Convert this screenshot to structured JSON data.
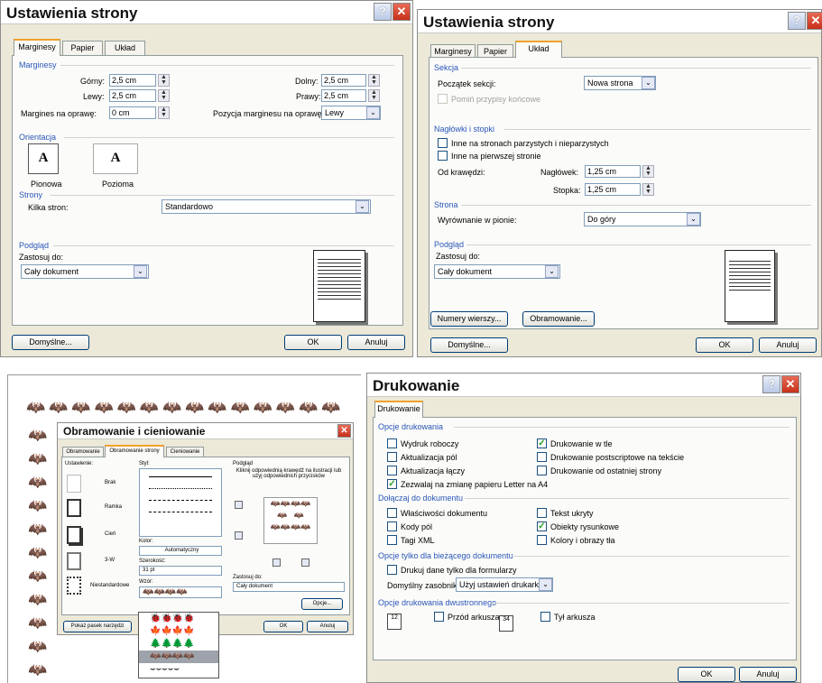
{
  "pageSetupA": {
    "title": "Ustawienia strony",
    "tabs": [
      "Marginesy",
      "Papier",
      "Układ"
    ],
    "margins": {
      "section": "Marginesy",
      "top_label": "Górny:",
      "top": "2,5 cm",
      "left_label": "Lewy:",
      "left": "2,5 cm",
      "gutter_label": "Margines na oprawę:",
      "gutter": "0 cm",
      "bottom_label": "Dolny:",
      "bottom": "2,5 cm",
      "right_label": "Prawy:",
      "right": "2,5 cm",
      "gutterpos_label": "Pozycja marginesu na oprawę:",
      "gutterpos": "Lewy"
    },
    "orientation": {
      "section": "Orientacja",
      "portrait": "Pionowa",
      "landscape": "Pozioma"
    },
    "pages": {
      "section": "Strony",
      "multiple_label": "Kilka stron:",
      "multiple": "Standardowo"
    },
    "preview": {
      "section": "Podgląd",
      "apply_label": "Zastosuj do:",
      "apply": "Cały dokument"
    },
    "default_btn": "Domyślne...",
    "ok": "OK",
    "cancel": "Anuluj"
  },
  "pageSetupB": {
    "title": "Ustawienia strony",
    "tabs": [
      "Marginesy",
      "Papier",
      "Układ"
    ],
    "section": {
      "title": "Sekcja",
      "start_label": "Początek sekcji:",
      "start": "Nowa strona",
      "suppress": "Pomiń przypisy końcowe"
    },
    "headers": {
      "title": "Nagłówki i stopki",
      "odd_even": "Inne na stronach parzystych i nieparzystych",
      "first": "Inne na pierwszej stronie",
      "from_edge": "Od krawędzi:",
      "header_label": "Nagłówek:",
      "header": "1,25 cm",
      "footer_label": "Stopka:",
      "footer": "1,25 cm"
    },
    "page": {
      "title": "Strona",
      "valign_label": "Wyrównanie w pionie:",
      "valign": "Do góry"
    },
    "preview": {
      "title": "Podgląd",
      "apply_label": "Zastosuj do:",
      "apply": "Cały dokument"
    },
    "line_numbers": "Numery wierszy...",
    "borders": "Obramowanie...",
    "default_btn": "Domyślne...",
    "ok": "OK",
    "cancel": "Anuluj"
  },
  "borders": {
    "title": "Obramowanie i cieniowanie",
    "tabs": [
      "Obramowanie",
      "Obramowanie strony",
      "Cieniowanie"
    ],
    "settings_label": "Ustawienie:",
    "settings": [
      "Brak",
      "Ramka",
      "Cień",
      "3-W",
      "Niestandardowe"
    ],
    "style_label": "Styl:",
    "color_label": "Kolor:",
    "color": "Automatyczny",
    "width_label": "Szerokość:",
    "width": "31 pt",
    "art_label": "Wzór:",
    "preview_label": "Podgląd",
    "preview_hint": "Kliknij odpowiednią krawędź na ilustracji lub użyj odpowiednich przycisków",
    "apply_label": "Zastosuj do:",
    "apply": "Cały dokument",
    "options": "Opcje...",
    "toolbar_btn": "Pokaż pasek narzędzi",
    "ok": "OK",
    "cancel": "Anuluj"
  },
  "print": {
    "title": "Drukowanie",
    "tab": "Drukowanie",
    "opts_title": "Opcje drukowania",
    "opts": [
      {
        "label": "Wydruk roboczy",
        "checked": false
      },
      {
        "label": "Drukowanie w tle",
        "checked": true
      },
      {
        "label": "Aktualizacja pól",
        "checked": false
      },
      {
        "label": "Drukowanie postscriptowe na tekście",
        "checked": false
      },
      {
        "label": "Aktualizacja łączy",
        "checked": false
      },
      {
        "label": "Drukowanie od ostatniej strony",
        "checked": false
      },
      {
        "label": "Zezwalaj na zmianę papieru Letter na A4",
        "checked": true
      }
    ],
    "include_title": "Dołączaj do dokumentu",
    "include": [
      {
        "label": "Właściwości dokumentu",
        "checked": false
      },
      {
        "label": "Tekst ukryty",
        "checked": false
      },
      {
        "label": "Kody pól",
        "checked": false
      },
      {
        "label": "Obiekty rysunkowe",
        "checked": true
      },
      {
        "label": "Tagi XML",
        "checked": false
      },
      {
        "label": "Kolory i obrazy tła",
        "checked": false
      }
    ],
    "current_title": "Opcje tylko dla bieżącego dokumentu",
    "forms_only": "Drukuj dane tylko dla formularzy",
    "tray_label": "Domyślny zasobnik:",
    "tray": "Użyj ustawień drukarki",
    "duplex_title": "Opcje drukowania dwustronnego",
    "front": "Przód arkusza",
    "back": "Tył arkusza",
    "ok": "OK",
    "cancel": "Anuluj"
  }
}
